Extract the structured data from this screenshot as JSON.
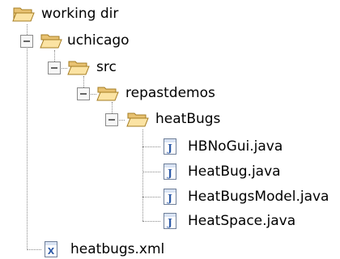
{
  "tree": {
    "root": {
      "label": "working dir",
      "icon": "open-folder-icon"
    },
    "items": [
      {
        "label": "uchicago",
        "icon": "open-folder-icon",
        "expanded": true
      },
      {
        "label": "src",
        "icon": "open-folder-icon",
        "expanded": true
      },
      {
        "label": "repastdemos",
        "icon": "open-folder-icon",
        "expanded": true
      },
      {
        "label": "heatBugs",
        "icon": "open-folder-icon",
        "expanded": true
      },
      {
        "label": "HBNoGui.java",
        "icon": "java-file-icon"
      },
      {
        "label": "HeatBug.java",
        "icon": "java-file-icon"
      },
      {
        "label": "HeatBugsModel.java",
        "icon": "java-file-icon"
      },
      {
        "label": "HeatSpace.java",
        "icon": "java-file-icon"
      },
      {
        "label": "heatbugs.xml",
        "icon": "xml-file-icon"
      }
    ],
    "toggle_symbol": "−"
  }
}
